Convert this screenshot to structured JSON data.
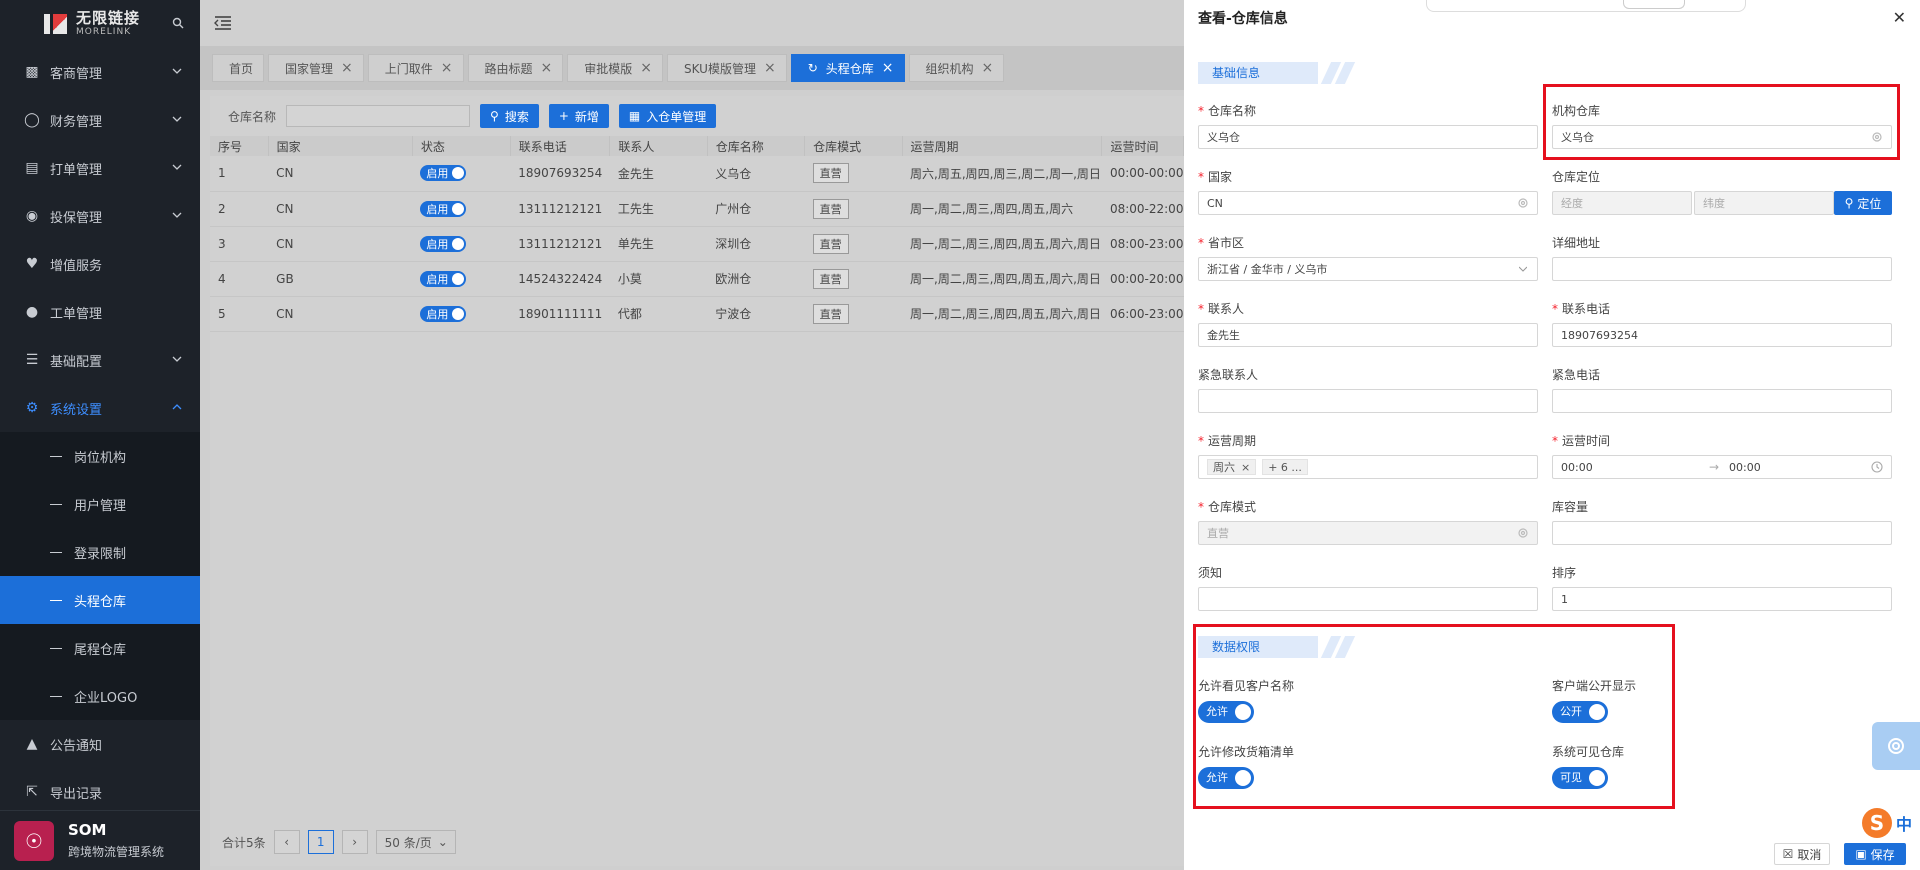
{
  "brand": {
    "name_cn": "无限链接",
    "name_en": "MORELINK"
  },
  "sidebar": {
    "menus": [
      {
        "label": "客商管理",
        "icon": "users-icon"
      },
      {
        "label": "财务管理",
        "icon": "yen-icon"
      },
      {
        "label": "打单管理",
        "icon": "print-icon"
      },
      {
        "label": "投保管理",
        "icon": "shield-icon"
      },
      {
        "label": "增值服务",
        "icon": "heart-hand-icon"
      },
      {
        "label": "工单管理",
        "icon": "user-icon"
      },
      {
        "label": "基础配置",
        "icon": "layers-icon"
      },
      {
        "label": "系统设置",
        "icon": "gear-icon"
      }
    ],
    "submenu": [
      "岗位机构",
      "用户管理",
      "登录限制",
      "头程仓库",
      "尾程仓库",
      "企业LOGO"
    ],
    "bottom_menus": [
      {
        "label": "公告通知",
        "icon": "bell-icon"
      },
      {
        "label": "导出记录",
        "icon": "export-icon"
      }
    ],
    "footer": {
      "title": "SOM",
      "subtitle": "跨境物流管理系统"
    }
  },
  "tabs": [
    "首页",
    "国家管理",
    "上门取件",
    "路由标题",
    "审批模版",
    "SKU模版管理",
    "头程仓库",
    "组织机构"
  ],
  "filter": {
    "label": "仓库名称",
    "search_btn": "搜索",
    "add_btn": "新增",
    "inbound_btn": "入仓单管理"
  },
  "table": {
    "columns": [
      "序号",
      "国家",
      "状态",
      "联系电话",
      "联系人",
      "仓库名称",
      "仓库模式",
      "运营周期",
      "运营时间"
    ],
    "rows": [
      [
        "1",
        "CN",
        "启用",
        "18907693254",
        "金先生",
        "义乌仓",
        "直营",
        "周六,周五,周四,周三,周二,周一,周日",
        "00:00-00:00"
      ],
      [
        "2",
        "CN",
        "启用",
        "13111212121",
        "工先生",
        "广州仓",
        "直营",
        "周一,周二,周三,周四,周五,周六",
        "08:00-22:00"
      ],
      [
        "3",
        "CN",
        "启用",
        "13111212121",
        "单先生",
        "深圳仓",
        "直营",
        "周一,周二,周三,周四,周五,周六,周日",
        "08:00-23:00"
      ],
      [
        "4",
        "GB",
        "启用",
        "14524322424",
        "小莫",
        "欧洲仓",
        "直营",
        "周一,周二,周三,周四,周五,周六,周日",
        "00:00-20:00"
      ],
      [
        "5",
        "CN",
        "启用",
        "18901111111",
        "代都",
        "宁波仓",
        "直营",
        "周一,周二,周三,周四,周五,周六,周日",
        "06:00-23:00"
      ]
    ]
  },
  "pager": {
    "total": "合计5条",
    "current": "1",
    "size": "50 条/页"
  },
  "drawer": {
    "title": "查看-仓库信息",
    "section_basic": "基础信息",
    "section_perm": "数据权限",
    "fields": {
      "warehouse_name": {
        "label": "仓库名称",
        "value": "义乌仓"
      },
      "org_warehouse": {
        "label": "机构仓库",
        "value": "义乌仓"
      },
      "country": {
        "label": "国家",
        "value": "CN"
      },
      "location": {
        "label": "仓库定位",
        "lng_placeholder": "经度",
        "lat_placeholder": "纬度",
        "locate_btn": "定位"
      },
      "region": {
        "label": "省市区",
        "value": "浙江省 / 金华市 / 义乌市"
      },
      "address": {
        "label": "详细地址",
        "value": ""
      },
      "contact": {
        "label": "联系人",
        "value": "金先生"
      },
      "phone": {
        "label": "联系电话",
        "value": "18907693254"
      },
      "emergency_contact": {
        "label": "紧急联系人",
        "value": ""
      },
      "emergency_phone": {
        "label": "紧急电话",
        "value": ""
      },
      "cycle": {
        "label": "运营周期",
        "chip": "周六",
        "more": "+ 6 ..."
      },
      "op_time": {
        "label": "运营时间",
        "start": "00:00",
        "end": "00:00"
      },
      "mode": {
        "label": "仓库模式",
        "value": "直营"
      },
      "capacity": {
        "label": "库容量",
        "value": ""
      },
      "notice": {
        "label": "须知",
        "value": ""
      },
      "sort": {
        "label": "排序",
        "value": "1"
      }
    },
    "perms": {
      "see_customer": {
        "label": "允许看见客户名称",
        "toggle": "允许"
      },
      "client_public": {
        "label": "客户端公开显示",
        "toggle": "公开"
      },
      "edit_manifest": {
        "label": "允许修改货箱清单",
        "toggle": "允许"
      },
      "system_visible": {
        "label": "系统可见仓库",
        "toggle": "可见"
      }
    },
    "cancel_btn": "取消",
    "save_btn": "保存"
  },
  "ime": {
    "logo": "S",
    "mode": "中"
  },
  "colors": {
    "primary": "#1c6fd9",
    "highlight": "#e5101e",
    "sidebar_bg": "#1d2229"
  }
}
